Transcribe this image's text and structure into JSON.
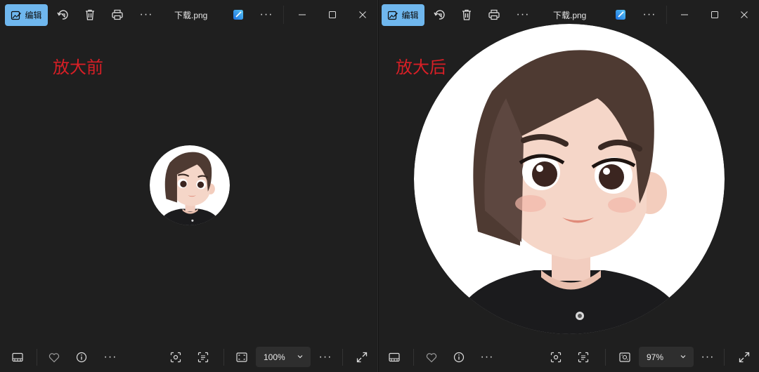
{
  "left": {
    "edit_label": "编辑",
    "file_title": "下载.png",
    "annotation": "放大前",
    "zoom": "100%"
  },
  "right": {
    "edit_label": "编辑",
    "file_title": "下载.png",
    "annotation": "放大后",
    "zoom": "97%"
  },
  "colors": {
    "accent": "#6fb7ee",
    "annotation": "#d81f26",
    "window_bg": "#1f1f1f"
  },
  "icons": [
    "image-edit-icon",
    "rotate-icon",
    "delete-icon",
    "print-icon",
    "more-icon",
    "ai-edit-icon",
    "minimize-icon",
    "maximize-icon",
    "close-icon",
    "filmstrip-icon",
    "favorite-icon",
    "info-icon",
    "visual-search-icon",
    "text-scan-icon",
    "fit-window-icon",
    "actual-size-icon",
    "chevron-down-icon",
    "fullscreen-icon"
  ]
}
